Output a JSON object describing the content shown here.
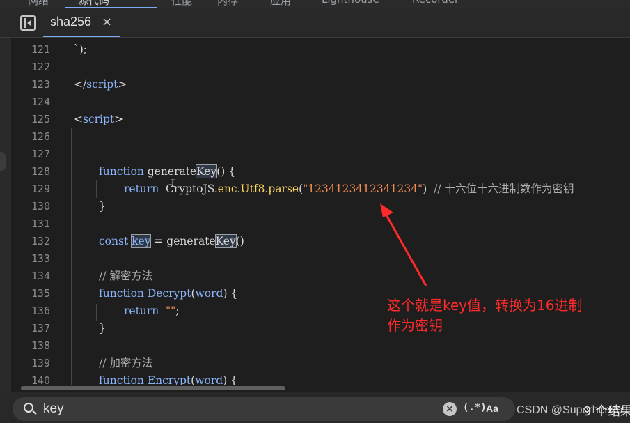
{
  "panel_tabs": [
    {
      "label": "网络"
    },
    {
      "label": "源代码",
      "active": true
    },
    {
      "label": "性能"
    },
    {
      "label": "内存"
    },
    {
      "label": "应用"
    },
    {
      "label": "Lighthouse"
    },
    {
      "label": "Recorder"
    }
  ],
  "file_tab": {
    "label": "sha256",
    "close_glyph": "×"
  },
  "editor": {
    "lines": [
      {
        "n": "121"
      },
      {
        "n": "122"
      },
      {
        "n": "123"
      },
      {
        "n": "124"
      },
      {
        "n": "125"
      },
      {
        "n": "126"
      },
      {
        "n": "127"
      },
      {
        "n": "128"
      },
      {
        "n": "129"
      },
      {
        "n": "130"
      },
      {
        "n": "131"
      },
      {
        "n": "132"
      },
      {
        "n": "133"
      },
      {
        "n": "134"
      },
      {
        "n": "135"
      },
      {
        "n": "136"
      },
      {
        "n": "137"
      },
      {
        "n": "138"
      },
      {
        "n": "139"
      },
      {
        "n": "140"
      }
    ],
    "code": {
      "l121": "`);",
      "l123_open": "</",
      "l123_name": "script",
      "l123_close": ">",
      "l125_open": "<",
      "l125_name": "script",
      "l125_close": ">",
      "kw_function": "function",
      "l128_name_a": "generate",
      "l128_name_b": "Key",
      "l128_tail": "() {",
      "kw_return": "return",
      "l129_obj": "CryptoJS.",
      "l129_enc": "enc",
      "l129_dot1": ".",
      "l129_utf8": "Utf8",
      "l129_dot2": ".",
      "l129_parse": "parse",
      "l129_lp": "(",
      "l129_str": "\"1234123412341234\"",
      "l129_rp": ")",
      "l129_comment": "  // 十六位十六进制数作为密钥",
      "l130": "}",
      "kw_const": "const",
      "l132_var": "key",
      "l132_eq": " = generate",
      "l132_key": "Key",
      "l132_tail": "()",
      "l134_comment": "// 解密方法",
      "l135_name": "Decrypt",
      "l135_lp": "(",
      "l135_param": "word",
      "l135_tail": ") {",
      "l136_str": "\"\"",
      "l136_semi": ";",
      "l137": "}",
      "l139_comment": "// 加密方法",
      "l140_name": "Encrypt",
      "l140_lp": "(",
      "l140_param": "word",
      "l140_tail": ") {"
    }
  },
  "annotation": {
    "line1": "这个就是key值，转换为16进制",
    "line2": "作为密钥",
    "color": "#ff2a2a"
  },
  "search": {
    "value": "key",
    "placeholder": "",
    "regex_label": "(.*)",
    "match_case_label": "Aa",
    "match_count": "9 个结果"
  },
  "watermark": "CSDN @SuperherRo",
  "icons": {
    "sidebar_toggle": "sidebar-toggle-icon",
    "search": "search-icon",
    "clear": "clear-icon"
  }
}
